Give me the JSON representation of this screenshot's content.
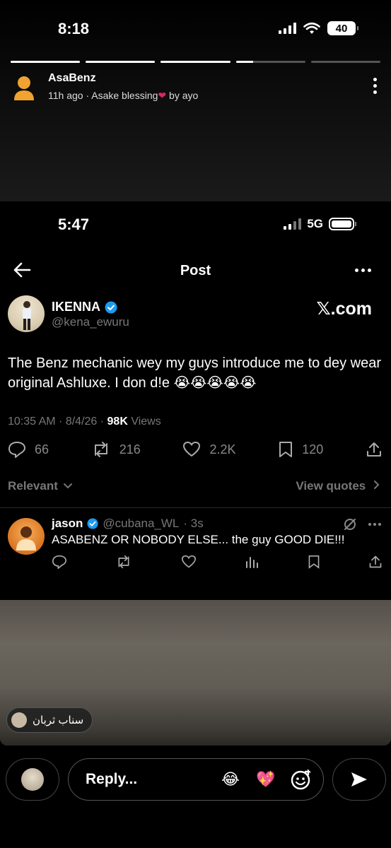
{
  "story": {
    "status_time": "8:18",
    "battery": "40",
    "username": "AsaBenz",
    "meta_prefix": "11h ago · Asake blessing",
    "meta_suffix": "by ayo",
    "progress_segments": [
      1,
      1,
      1,
      0.25,
      0
    ]
  },
  "screenshot": {
    "status_time": "5:47",
    "network": "5G",
    "title": "Post",
    "watermark": "𝕏.com",
    "author": {
      "name": "IKENNA",
      "handle": "@kena_ewuru"
    },
    "tweet_text": "The Benz mechanic wey my guys introduce me to dey wear original Ashluxe. I don d!e 😭😭😭😭😭",
    "meta": {
      "datetime": "10:35 AM · 8/4/26 · ",
      "views_count": "98K",
      "views_label": " Views"
    },
    "stats": {
      "replies": "66",
      "reposts": "216",
      "likes": "2.2K",
      "bookmarks": "120"
    },
    "sort_label": "Relevant",
    "view_quotes_label": "View quotes",
    "reply": {
      "name": "jason",
      "handle": "@cubana_WL",
      "time": "· 3s",
      "text": "ASABENZ OR NOBODY ELSE... the guy GOOD DIE!!!"
    }
  },
  "footer": {
    "sticker_text": "سناب ثربان",
    "reply_placeholder": "Reply...",
    "emoji_1": "😂",
    "emoji_2": "💖"
  },
  "colors": {
    "verified": "#1d9bf0",
    "heart": "#e0245e",
    "muted": "#777777"
  }
}
